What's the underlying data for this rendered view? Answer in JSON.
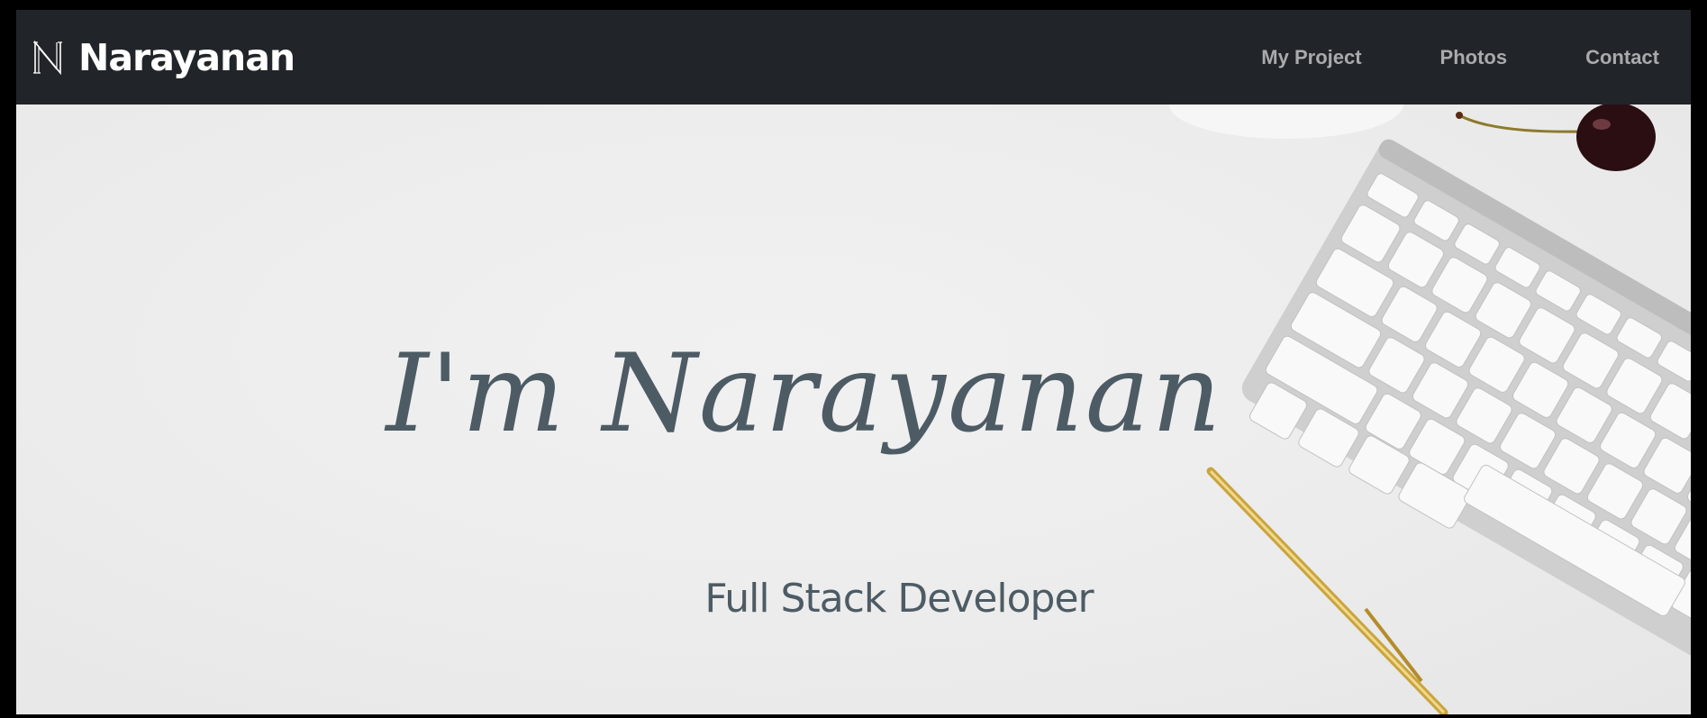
{
  "brand": {
    "name": "Narayanan",
    "logo_icon": "n-monogram-icon"
  },
  "nav": {
    "items": [
      {
        "label": "My Project"
      },
      {
        "label": "Photos"
      },
      {
        "label": "Contact"
      }
    ]
  },
  "hero": {
    "title": "I'm Narayanan",
    "subtitle": "Full Stack Developer",
    "background_image": "desk-with-keyboard-pen-cherry"
  },
  "colors": {
    "navbar_bg": "#212529",
    "nav_link": "#a9aaac",
    "brand_text": "#ffffff",
    "hero_text": "#4d5b64",
    "hero_bg": "#ededed"
  }
}
